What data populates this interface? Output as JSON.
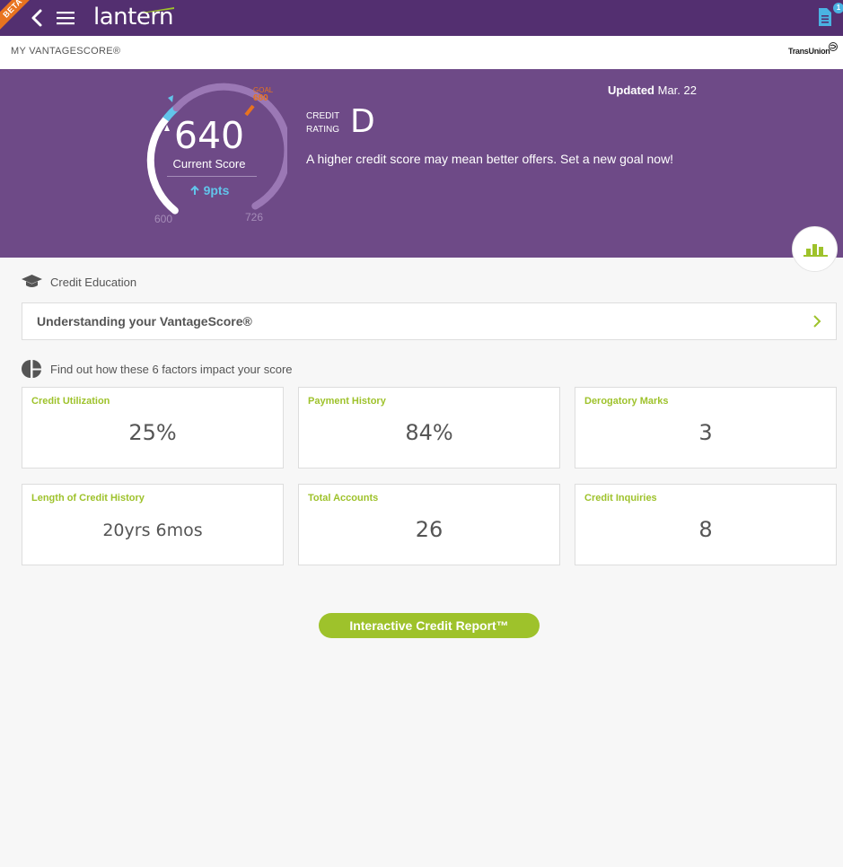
{
  "header": {
    "beta_label": "BETA",
    "logo_text": "lantern",
    "notification_count": "1",
    "brand_color": "#532f70",
    "accent_color": "#9ec22b"
  },
  "subheader": {
    "title": "MY VANTAGESCORE®",
    "partner": "TransUnion"
  },
  "score_panel": {
    "score": "640",
    "score_label": "Current Score",
    "score_change": "9pts",
    "gauge_min": "600",
    "gauge_max": "726",
    "goal_label": "GOAL",
    "goal_value": "680",
    "rating_label_line1": "CREDIT",
    "rating_label_line2": "RATING",
    "rating": "D",
    "message": "A higher credit score may mean better offers. Set a new goal now!",
    "updated_label": "Updated",
    "updated_date": "Mar. 22"
  },
  "education": {
    "heading": "Credit Education",
    "card_title": "Understanding your VantageScore®"
  },
  "factors": {
    "heading": "Find out how these 6 factors impact your score",
    "items": [
      {
        "label": "Credit Utilization",
        "value": "25%"
      },
      {
        "label": "Payment History",
        "value": "84%"
      },
      {
        "label": "Derogatory Marks",
        "value": "3"
      },
      {
        "label": "Length of Credit History",
        "value": "20yrs 6mos"
      },
      {
        "label": "Total Accounts",
        "value": "26"
      },
      {
        "label": "Credit Inquiries",
        "value": "8"
      }
    ]
  },
  "cta": {
    "label": "Interactive Credit Report™"
  },
  "icons": [
    "back-icon",
    "hamburger-menu-icon",
    "document-icon",
    "graduation-cap-icon",
    "pie-chart-icon",
    "chevron-right-icon",
    "bar-chart-icon",
    "arrow-up-icon"
  ]
}
